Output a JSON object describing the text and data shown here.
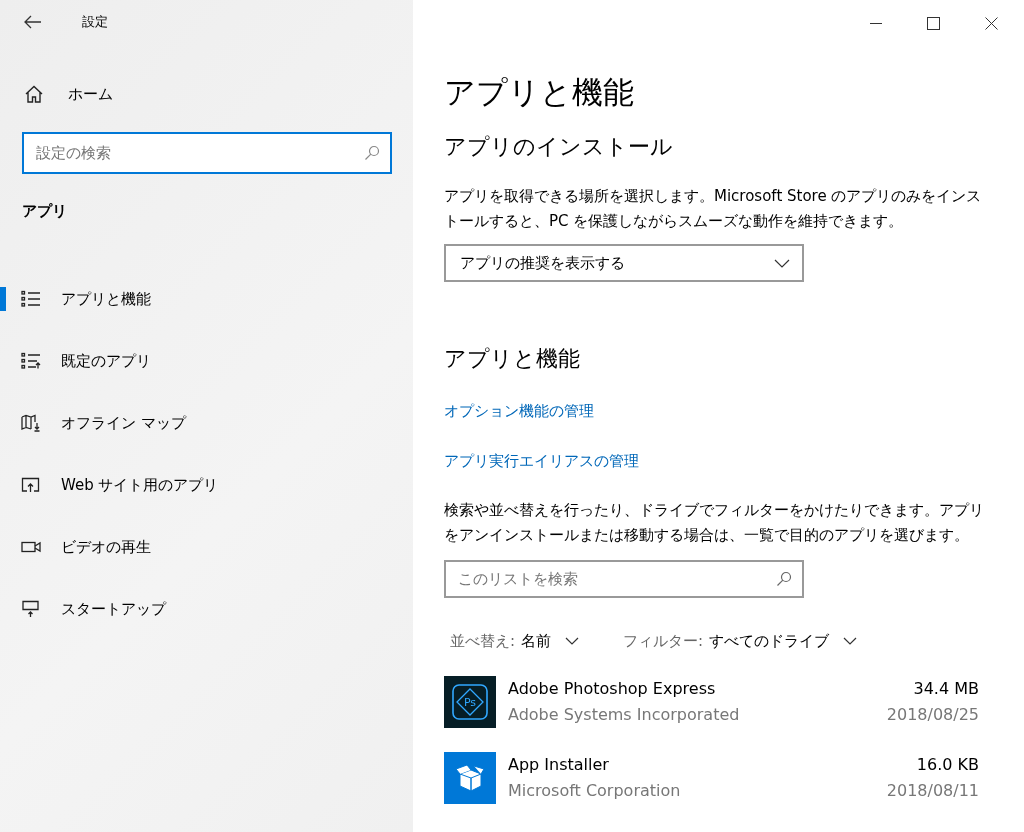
{
  "window": {
    "title": "設定"
  },
  "sidebar": {
    "home": "ホーム",
    "search": {
      "placeholder": "設定の検索"
    },
    "section": "アプリ",
    "items": [
      {
        "label": "アプリと機能",
        "kind": "list",
        "selected": true
      },
      {
        "label": "既定のアプリ",
        "kind": "defaults",
        "selected": false
      },
      {
        "label": "オフライン マップ",
        "kind": "map",
        "selected": false
      },
      {
        "label": "Web サイト用のアプリ",
        "kind": "web",
        "selected": false
      },
      {
        "label": "ビデオの再生",
        "kind": "video",
        "selected": false
      },
      {
        "label": "スタートアップ",
        "kind": "startup",
        "selected": false
      }
    ]
  },
  "page": {
    "title": "アプリと機能",
    "install": {
      "heading": "アプリのインストール",
      "text": "アプリを取得できる場所を選択します。Microsoft Store のアプリのみをインストールすると、PC を保護しながらスムーズな動作を維持できます。",
      "dropdown": "アプリの推奨を表示する"
    },
    "features": {
      "heading": "アプリと機能",
      "links": [
        "オプション機能の管理",
        "アプリ実行エイリアスの管理"
      ],
      "text": "検索や並べ替えを行ったり、ドライブでフィルターをかけたりできます。アプリをアンインストールまたは移動する場合は、一覧で目的のアプリを選びます。",
      "search": {
        "placeholder": "このリストを検索"
      },
      "sort": {
        "label": "並べ替え:",
        "value": "名前"
      },
      "filter": {
        "label": "フィルター:",
        "value": "すべてのドライブ"
      },
      "apps": [
        {
          "name": "Adobe Photoshop Express",
          "publisher": "Adobe Systems Incorporated",
          "size": "34.4 MB",
          "date": "2018/08/25",
          "kind": "photoshop",
          "icon_text": "Ps"
        },
        {
          "name": "App Installer",
          "publisher": "Microsoft Corporation",
          "size": "16.0 KB",
          "date": "2018/08/11",
          "kind": "installer"
        }
      ]
    }
  }
}
